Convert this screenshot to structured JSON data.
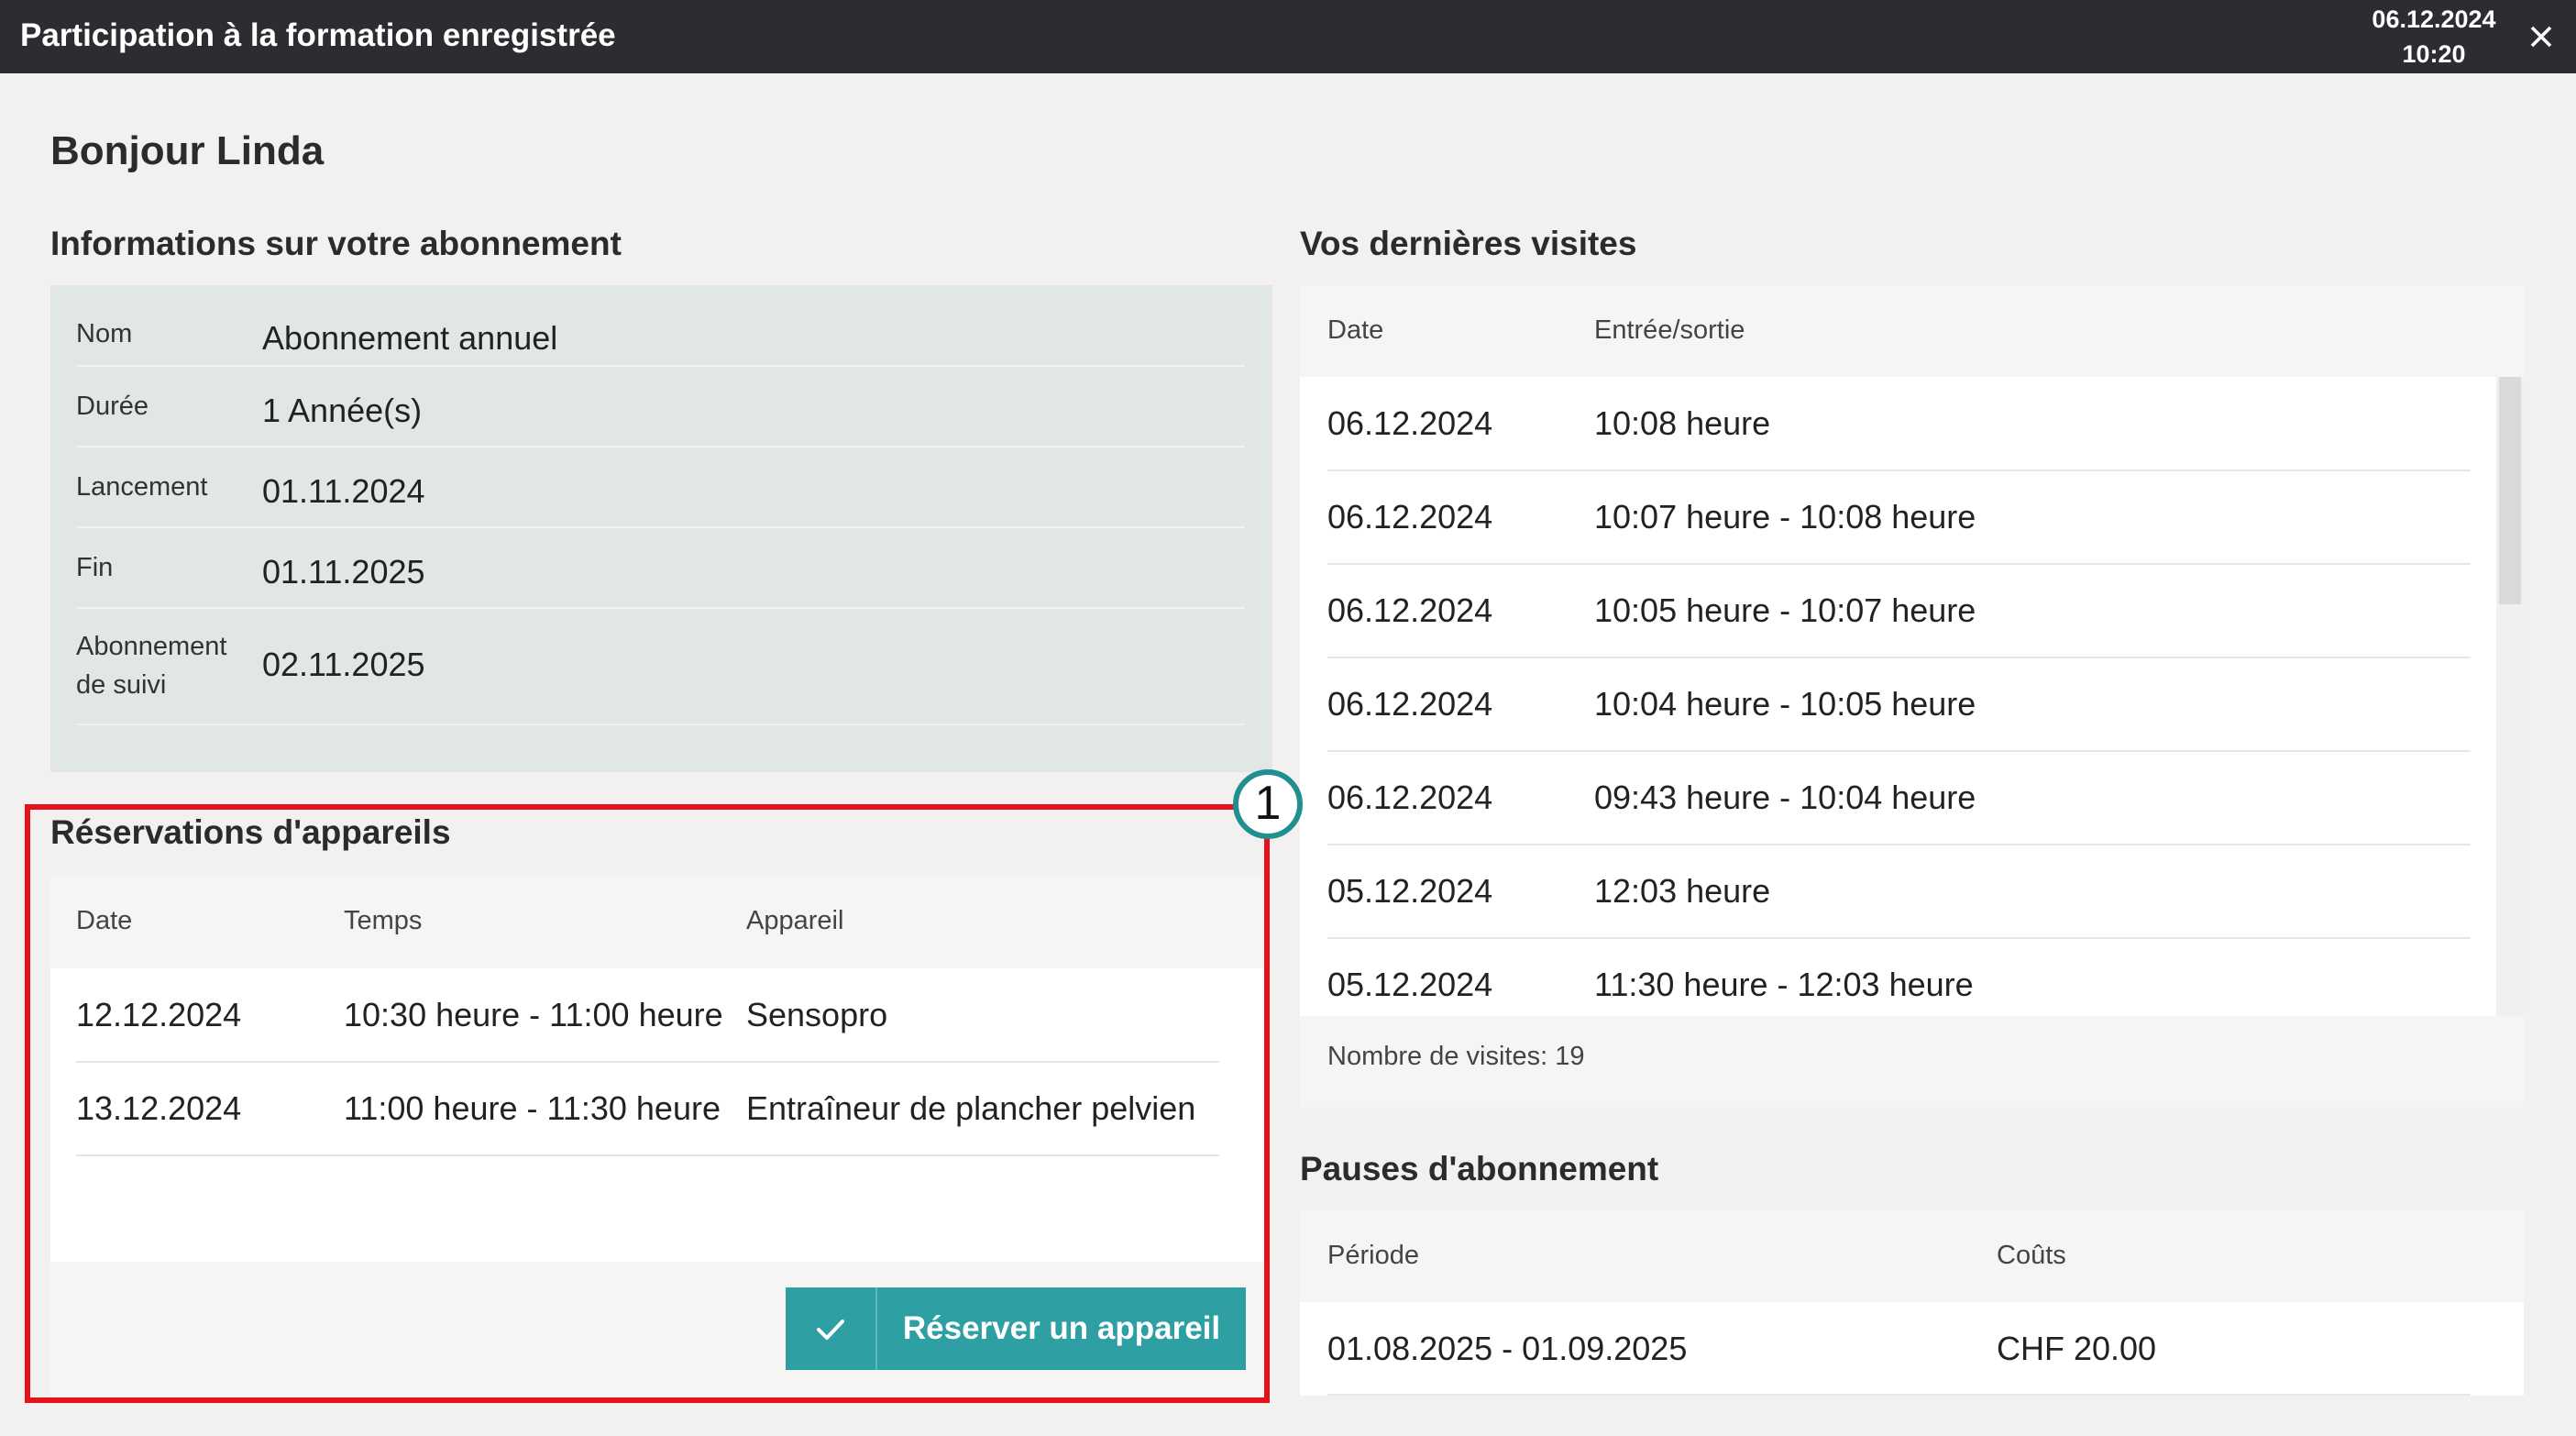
{
  "window": {
    "title": "Participation à la formation enregistrée",
    "date": "06.12.2024",
    "time": "10:20"
  },
  "greeting": "Bonjour Linda",
  "subscription": {
    "title": "Informations sur votre abonnement",
    "rows": [
      {
        "label": "Nom",
        "value": "Abonnement annuel"
      },
      {
        "label": "Durée",
        "value": "1 Année(s)"
      },
      {
        "label": "Lancement",
        "value": "01.11.2024"
      },
      {
        "label": "Fin",
        "value": "01.11.2025"
      },
      {
        "label": "Abonnement de suivi",
        "value": "02.11.2025"
      }
    ]
  },
  "visits": {
    "title": "Vos dernières visites",
    "columns": [
      "Date",
      "Entrée/sortie"
    ],
    "rows": [
      {
        "date": "06.12.2024",
        "time": "10:08 heure"
      },
      {
        "date": "06.12.2024",
        "time": "10:07 heure - 10:08 heure"
      },
      {
        "date": "06.12.2024",
        "time": "10:05 heure - 10:07 heure"
      },
      {
        "date": "06.12.2024",
        "time": "10:04 heure - 10:05 heure"
      },
      {
        "date": "06.12.2024",
        "time": "09:43 heure - 10:04 heure"
      },
      {
        "date": "05.12.2024",
        "time": "12:03 heure"
      },
      {
        "date": "05.12.2024",
        "time": "11:30 heure - 12:03 heure"
      }
    ],
    "count_label": "Nombre de visites: 19"
  },
  "reservations": {
    "title": "Réservations d'appareils",
    "columns": [
      "Date",
      "Temps",
      "Appareil"
    ],
    "rows": [
      {
        "date": "12.12.2024",
        "time": "10:30 heure - 11:00 heure",
        "device": "Sensopro"
      },
      {
        "date": "13.12.2024",
        "time": "11:00 heure - 11:30 heure",
        "device": "Entraîneur de plancher pelvien"
      }
    ],
    "button_label": "Réserver un appareil"
  },
  "pauses": {
    "title": "Pauses d'abonnement",
    "columns": [
      "Période",
      "Coûts"
    ],
    "rows": [
      {
        "period": "01.08.2025 - 01.09.2025",
        "cost": "CHF 20.00"
      }
    ]
  },
  "annotation": {
    "marker": "1"
  },
  "colors": {
    "titlebar": "#2b2d30",
    "accent": "#2e9fa3",
    "highlight": "#e3121b",
    "marker_ring": "#1f8f90",
    "panel": "#e1e6e6"
  }
}
